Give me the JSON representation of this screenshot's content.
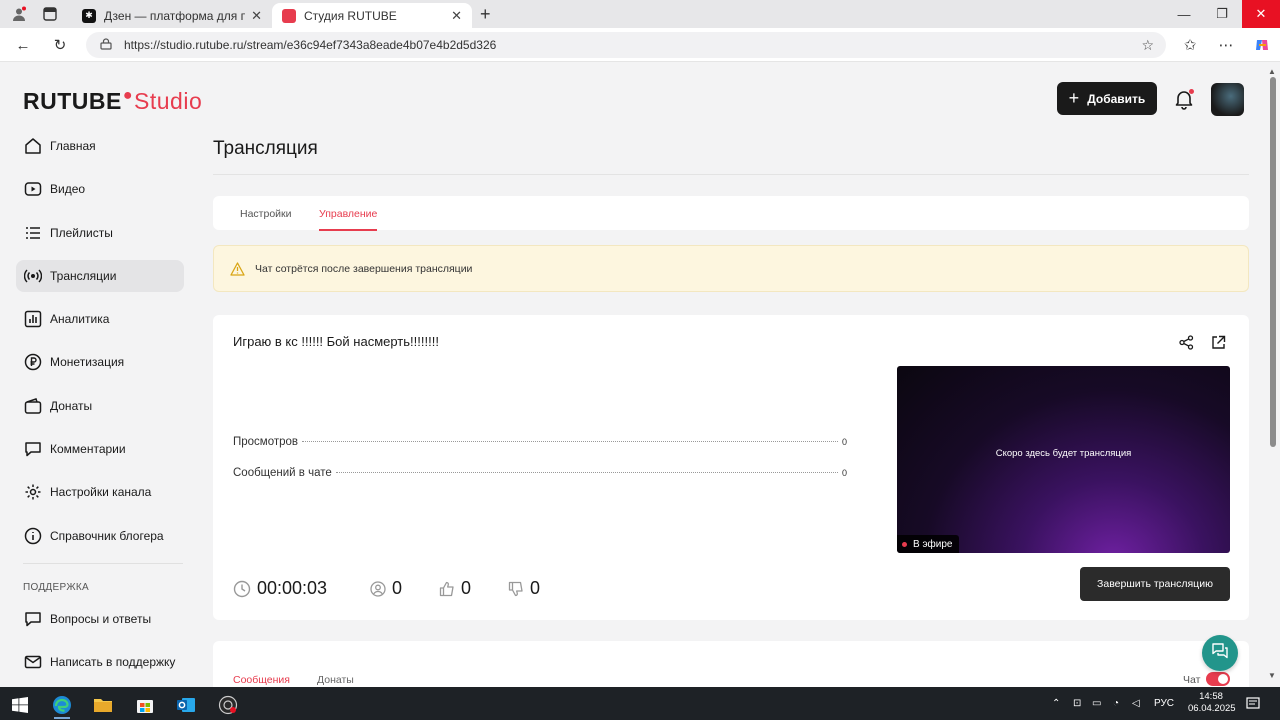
{
  "browser": {
    "tabs": [
      {
        "title": "Дзен — платформа для просмотра",
        "active": false
      },
      {
        "title": "Студия RUTUBE",
        "active": true
      }
    ],
    "url": "https://studio.rutube.ru/stream/e36c94ef7343a8eade4b07e4b2d5d326"
  },
  "header": {
    "logo_main": "RUTUBE",
    "logo_studio": "Studio",
    "add_button": "Добавить"
  },
  "sidebar": {
    "items": [
      {
        "label": "Главная",
        "icon": "home-icon"
      },
      {
        "label": "Видео",
        "icon": "video-icon"
      },
      {
        "label": "Плейлисты",
        "icon": "playlist-icon"
      },
      {
        "label": "Трансляции",
        "icon": "broadcast-icon",
        "active": true
      },
      {
        "label": "Аналитика",
        "icon": "analytics-icon"
      },
      {
        "label": "Монетизация",
        "icon": "ruble-icon"
      },
      {
        "label": "Донаты",
        "icon": "wallet-icon"
      },
      {
        "label": "Комментарии",
        "icon": "comment-icon"
      },
      {
        "label": "Настройки канала",
        "icon": "gear-icon"
      },
      {
        "label": "Справочник блогера",
        "icon": "info-icon"
      }
    ],
    "support_heading": "ПОДДЕРЖКА",
    "support_items": [
      {
        "label": "Вопросы и ответы",
        "icon": "chat-bubble-icon"
      },
      {
        "label": "Написать в поддержку",
        "icon": "mail-icon"
      }
    ]
  },
  "main": {
    "title": "Трансляция",
    "tabs": [
      {
        "label": "Настройки",
        "active": false
      },
      {
        "label": "Управление",
        "active": true
      }
    ],
    "alert": "Чат сотрётся после завершения трансляции",
    "stream": {
      "title": "Играю в кс !!!!!! Бой насмерть!!!!!!!!",
      "stats": [
        {
          "label": "Просмотров",
          "value": "0"
        },
        {
          "label": "Сообщений в чате",
          "value": "0"
        }
      ],
      "preview_text": "Скоро здесь будет трансляция",
      "live_badge": "В эфире",
      "timer": "00:00:03",
      "viewers": "0",
      "likes": "0",
      "dislikes": "0",
      "end_button": "Завершить трансляцию"
    },
    "chat": {
      "tabs": [
        {
          "label": "Сообщения",
          "active": true
        },
        {
          "label": "Донаты",
          "active": false
        }
      ],
      "toggle_label": "Чат",
      "toggle_on": true
    }
  },
  "taskbar": {
    "language": "РУС",
    "time": "14:58",
    "date": "06.04.2025"
  },
  "colors": {
    "accent": "#e73c4e",
    "dark_button": "#1a1a1a",
    "alert_bg": "#fdf6df",
    "support_fab": "#22958b"
  }
}
